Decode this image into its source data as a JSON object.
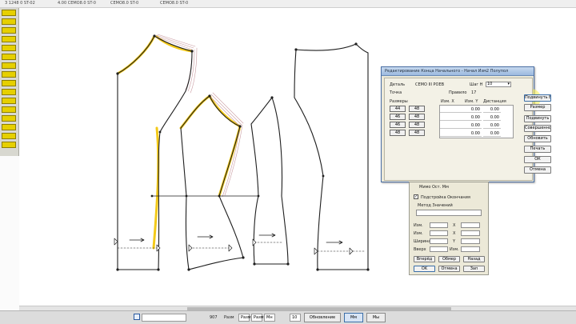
{
  "topbar": {
    "items": [
      "3  1248 0 ST-02",
      "4.00   CEMO8.0 ST-0",
      "CEMO8.0 ST-0",
      "CEMO8.0 ST-0"
    ]
  },
  "canvas": {
    "colors": {
      "pattern_line": "#1e1e1e",
      "highlight": "#f2c400",
      "grade_lines": "#c99aa0"
    }
  },
  "dialog": {
    "title": "Редактирование Конца Начального - Начал Изм2 Полупол",
    "detail_label": "Деталь",
    "detail_value": "CEMO III PОЕВ",
    "step_label": "Шаг Н",
    "step_value": "10",
    "point_label": "Точка",
    "rule_label": "Правило",
    "rule_value": "17",
    "col_sizes": "Размеры",
    "col_dx": "Изм. X",
    "col_dy": "Изм. Y",
    "col_dist": "Дистанция",
    "size_buttons": [
      [
        "44",
        "48"
      ],
      [
        "46",
        "48"
      ],
      [
        "46",
        "48"
      ],
      [
        "48",
        "48"
      ]
    ],
    "table": [
      [
        "0.00",
        "0.00"
      ],
      [
        "0.00",
        "0.00"
      ],
      [
        "0.00",
        "0.00"
      ],
      [
        "0.00",
        "0.00"
      ]
    ],
    "side_buttons": [
      "Подвинуть В",
      "Размер",
      "Подвинуть",
      "Совершенно",
      "Обновить",
      "Печать",
      "ОК",
      "Отмена"
    ]
  },
  "panel2": {
    "title": "Мимо Ост. Мм",
    "check_label": "Подстройка Окончания",
    "field_label": "Метод Значений",
    "row_labels": [
      "Изм.",
      "Изм.",
      "Ширина",
      "Вверх"
    ],
    "row_labels_right": [
      "X",
      "X",
      "Y",
      "Изм."
    ],
    "buttons1": [
      "Вперёд",
      "Обмер",
      "Назад"
    ],
    "buttons2": [
      "OK",
      "Отмена",
      "Зап"
    ]
  },
  "statusbar": {
    "value1": "907",
    "label_size": "Разм",
    "value_size": "Разм",
    "field_a": "Разм",
    "field_b": "Мн",
    "value_step": "10",
    "buttons": [
      "Обновление",
      "Мм",
      "Мы"
    ]
  }
}
